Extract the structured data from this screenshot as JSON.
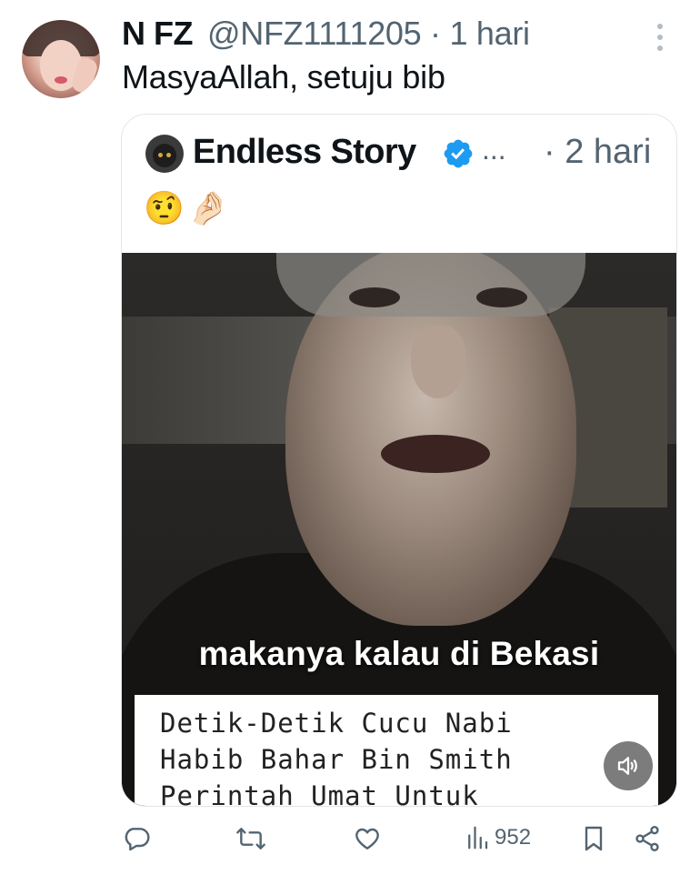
{
  "reply": {
    "display_name": "N FZ",
    "handle_time": "@NFZ1111205 · 1 hari",
    "text": "MasyaAllah, setuju bib"
  },
  "quoted": {
    "display_name": "Endless Story",
    "ellipsis": "...",
    "time": "· 2 hari",
    "emoji": "🤨🤌🏻",
    "video": {
      "caption": "makanya kalau di Bekasi",
      "overlay_lines": [
        "Detik-Detik Cucu Nabi",
        "Habib Bahar Bin Smith",
        "Perintah Umat Untuk"
      ]
    }
  },
  "actions": {
    "views": "952"
  },
  "colors": {
    "verified": "#1d9bf0",
    "muted_text": "#536471",
    "icon": "#536471"
  },
  "icons": [
    "more-icon",
    "verified-icon",
    "volume-icon",
    "reply-icon",
    "retweet-icon",
    "like-icon",
    "views-icon",
    "bookmark-icon",
    "share-icon"
  ]
}
